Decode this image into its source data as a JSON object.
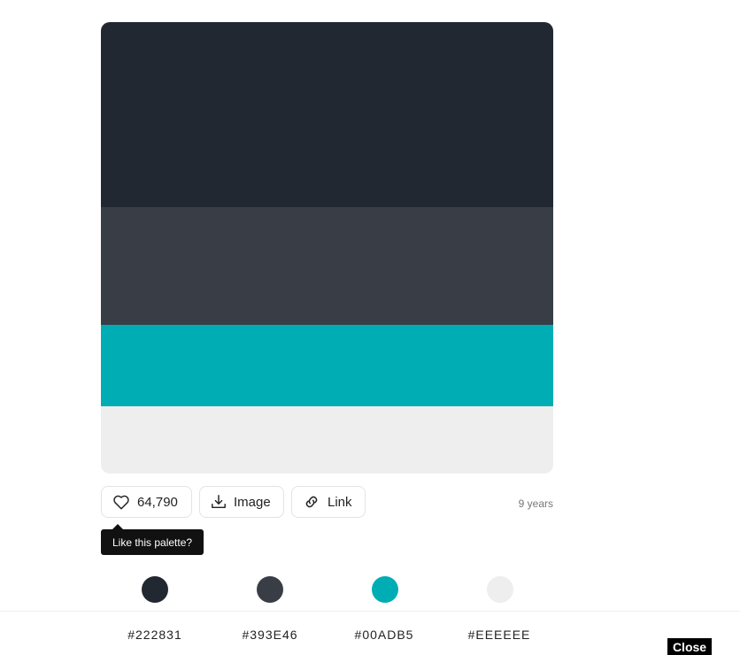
{
  "palette": {
    "colors": [
      {
        "hex": "#222831",
        "label": "#222831"
      },
      {
        "hex": "#393E46",
        "label": "#393E46"
      },
      {
        "hex": "#00ADB5",
        "label": "#00ADB5"
      },
      {
        "hex": "#EEEEEE",
        "label": "#EEEEEE"
      }
    ]
  },
  "actions": {
    "like_count": "64,790",
    "image_label": "Image",
    "link_label": "Link"
  },
  "age": "9 years",
  "tooltip": "Like this palette?",
  "close_label": "Close",
  "icons": {
    "like": "heart-icon",
    "image": "download-icon",
    "link": "link-icon"
  }
}
